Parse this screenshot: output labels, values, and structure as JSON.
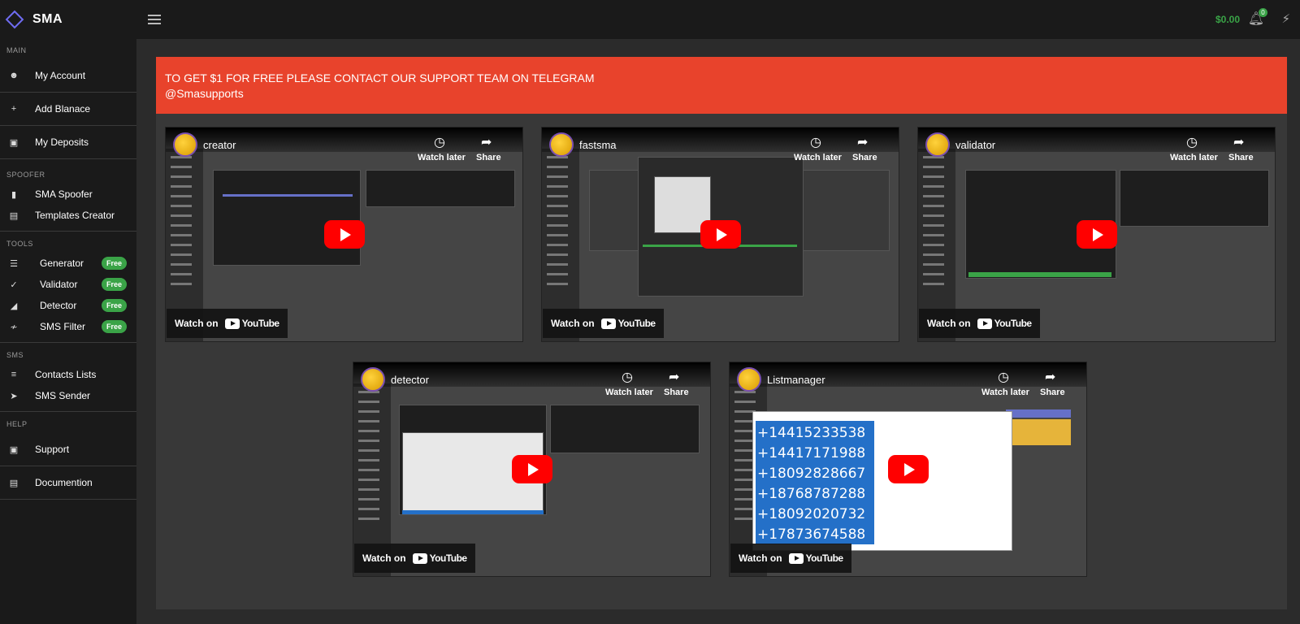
{
  "brand": {
    "name": "SMA"
  },
  "sidebar": {
    "sections": [
      {
        "title": "MAIN",
        "items": [
          {
            "label": "My Account",
            "icon": "user-circle-icon"
          },
          {
            "label": "Add Blanace",
            "icon": "plus-icon"
          },
          {
            "label": "My Deposits",
            "icon": "wallet-icon"
          }
        ]
      },
      {
        "title": "SPOOFER",
        "items": [
          {
            "label": "SMA Spoofer",
            "icon": "sms-spoofer-icon"
          },
          {
            "label": "Templates Creator",
            "icon": "clipboard-icon"
          }
        ]
      },
      {
        "title": "TOOLS",
        "items": [
          {
            "label": "Generator",
            "icon": "list-icon",
            "badge": "Free"
          },
          {
            "label": "Validator",
            "icon": "shield-check-icon",
            "badge": "Free"
          },
          {
            "label": "Detector",
            "icon": "eraser-icon",
            "badge": "Free"
          },
          {
            "label": "SMS Filter",
            "icon": "filter-icon",
            "badge": "Free"
          }
        ]
      },
      {
        "title": "SMS",
        "items": [
          {
            "label": "Contacts Lists",
            "icon": "contacts-list-icon"
          },
          {
            "label": "SMS Sender",
            "icon": "send-icon"
          }
        ]
      },
      {
        "title": "HELP",
        "items": [
          {
            "label": "Support",
            "icon": "support-icon"
          },
          {
            "label": "Documention",
            "icon": "doc-icon"
          }
        ]
      }
    ]
  },
  "topbar": {
    "balance": "$0.00",
    "notifications": "0"
  },
  "banner": {
    "line1": "TO GET $1 FOR FREE PLEASE CONTACT OUR SUPPORT TEAM ON TELEGRAM",
    "line2": "@Smasupports"
  },
  "videos": [
    {
      "title": "creator"
    },
    {
      "title": "fastsma"
    },
    {
      "title": "validator"
    },
    {
      "title": "detector"
    },
    {
      "title": "Listmanager"
    }
  ],
  "video_ui": {
    "watch_later": "Watch later",
    "share": "Share",
    "watch_on": "Watch on",
    "youtube": "YouTube"
  },
  "listmanager_numbers": [
    "+14415233538",
    "+14417171988",
    "+18092828667",
    "+18768787288",
    "+18092020732",
    "+17873674588"
  ]
}
